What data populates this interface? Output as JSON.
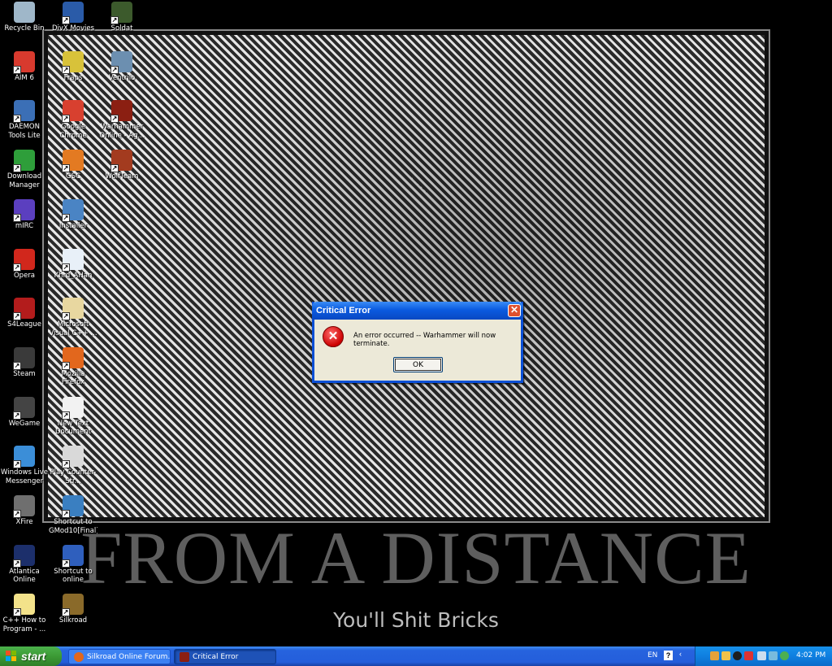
{
  "wallpaper": {
    "title": "FROM A DISTANCE",
    "subtitle": "You'll Shit Bricks"
  },
  "desktop": {
    "icons": [
      {
        "label": "Recycle Bin",
        "icon": "recycle-bin-icon",
        "color": "#9fb7c9"
      },
      {
        "label": "AIM 6",
        "icon": "aim-icon",
        "color": "#d83a2e"
      },
      {
        "label": "DAEMON Tools Lite",
        "icon": "daemon-tools-icon",
        "color": "#3b6fb6"
      },
      {
        "label": "Download Manager",
        "icon": "download-manager-icon",
        "color": "#2e9e3a"
      },
      {
        "label": "mIRC",
        "icon": "mirc-icon",
        "color": "#5b3fbf"
      },
      {
        "label": "Opera",
        "icon": "opera-icon",
        "color": "#d1271c"
      },
      {
        "label": "S4League",
        "icon": "s4league-icon",
        "color": "#b31c1c"
      },
      {
        "label": "Steam",
        "icon": "steam-icon",
        "color": "#3a3a3a"
      },
      {
        "label": "WeGame",
        "icon": "wegame-icon",
        "color": "#444444"
      },
      {
        "label": "Windows Live Messenger",
        "icon": "messenger-icon",
        "color": "#3b8ed8"
      },
      {
        "label": "XFire",
        "icon": "xfire-icon",
        "color": "#6f6f6f"
      },
      {
        "label": "Atlantica Online",
        "icon": "atlantica-icon",
        "color": "#1c2f6b"
      },
      {
        "label": "C++ How to Program - ...",
        "icon": "document-icon",
        "color": "#f3e28a"
      },
      {
        "label": "DivX Movies",
        "icon": "divx-icon",
        "color": "#2a5ba8"
      },
      {
        "label": "Fraps",
        "icon": "fraps-icon",
        "color": "#d8c23a"
      },
      {
        "label": "Google Chrome",
        "icon": "chrome-icon",
        "color": "#d8402f"
      },
      {
        "label": "GSC",
        "icon": "gsc-icon",
        "color": "#e37a22"
      },
      {
        "label": "Installer",
        "icon": "installer-icon",
        "color": "#4a84c4"
      },
      {
        "label": "Khrd_AHan",
        "icon": "image-file-icon",
        "color": "#e8f0f8"
      },
      {
        "label": "Microsoft Visual C++ ...",
        "icon": "visual-cpp-icon",
        "color": "#e8d7a0"
      },
      {
        "label": "Mozilla Firefox",
        "icon": "firefox-icon",
        "color": "#e2671d"
      },
      {
        "label": "New Text Document",
        "icon": "text-document-icon",
        "color": "#f2f2f2"
      },
      {
        "label": "Play Counter-Str...",
        "icon": "counter-strike-icon",
        "color": "#d9d9d9"
      },
      {
        "label": "Shortcut to GMod10[Final]",
        "icon": "gmod-icon",
        "color": "#3a7fc1"
      },
      {
        "label": "Shortcut to online",
        "icon": "window-icon",
        "color": "#2f5fbd"
      },
      {
        "label": "Silkroad",
        "icon": "silkroad-icon",
        "color": "#8a6a2a"
      },
      {
        "label": "Soldat",
        "icon": "soldat-icon",
        "color": "#3c5a2c"
      },
      {
        "label": "Ventrilo",
        "icon": "ventrilo-icon",
        "color": "#6c8fb0"
      },
      {
        "label": "Warhammer Online - Ag...",
        "icon": "warhammer-icon",
        "color": "#8b1f12"
      },
      {
        "label": "WolfTeam",
        "icon": "wolfteam-icon",
        "color": "#a33b1f"
      }
    ]
  },
  "dialog": {
    "title": "Critical Error",
    "close_glyph": "✕",
    "message": "An error occurred -- Warhammer will now terminate.",
    "ok_label": "OK",
    "icon": "error-icon",
    "icon_glyph": "✕"
  },
  "taskbar": {
    "start_label": "start",
    "tasks": [
      {
        "label": "Silkroad Online Forum...",
        "icon": "browser-icon"
      },
      {
        "label": "Critical Error",
        "icon": "warhammer-icon"
      }
    ],
    "language": "EN",
    "help_glyph": "?",
    "tray_arrow": "‹",
    "clock": "4:02 PM",
    "colors": {
      "taskbar": "#245edb",
      "start": "#3c9a35",
      "tray": "#0f7fe0"
    }
  }
}
